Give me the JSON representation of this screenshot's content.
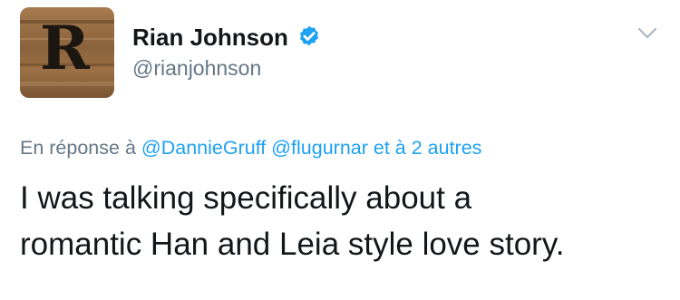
{
  "author": {
    "display_name": "Rian Johnson",
    "handle": "@rianjohnson",
    "verified": true,
    "avatar_letter": "R"
  },
  "reply_context": {
    "prefix": "En réponse à",
    "mentions": [
      "@DannieGruff",
      "@flugurnar"
    ],
    "suffix": "et à 2 autres"
  },
  "tweet": {
    "lines": [
      "I was talking specifically about a",
      "romantic Han and Leia style love story."
    ]
  },
  "colors": {
    "link": "#1da1f2",
    "secondary_text": "#657786",
    "primary_text": "#14171a",
    "verified_badge": "#1da1f2"
  },
  "icons": {
    "verified": "verified-badge-icon",
    "menu": "chevron-down-icon"
  }
}
